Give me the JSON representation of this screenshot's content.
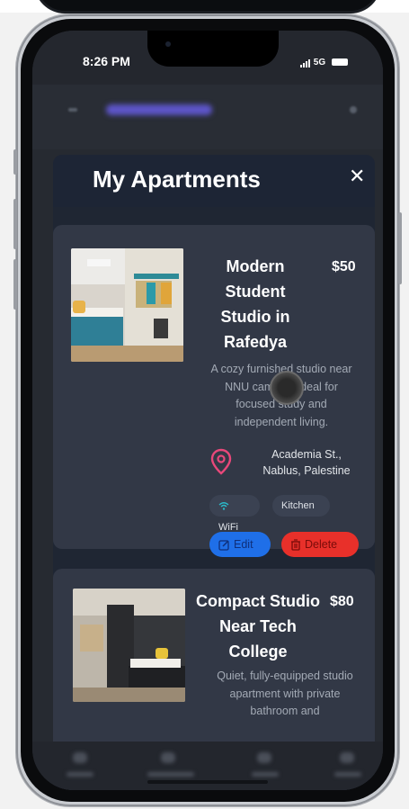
{
  "status_bar": {
    "time": "8:26 PM",
    "network": "5G"
  },
  "modal": {
    "title": "My Apartments",
    "close_label": "✕"
  },
  "apartments": [
    {
      "title": "Modern Student Studio in Rafedya",
      "price": "$50",
      "description": "A cozy furnished studio near NNU campus, ideal for focused study and independent living.",
      "location": "Academia St., Nablus, Palestine",
      "amenities": [
        "WiFi",
        "Kitchen"
      ],
      "edit_label": "Edit",
      "delete_label": "Delete"
    },
    {
      "title": "Compact Studio Near Tech College",
      "price": "$80",
      "description": "Quiet, fully-equipped studio apartment with private bathroom and"
    }
  ],
  "colors": {
    "accent": "#1f6fe8",
    "danger": "#e8302a",
    "location_pin": "#e8487a",
    "modal_bg": "#1d2535",
    "card_bg": "#323846"
  },
  "icons": [
    "location-pin-icon",
    "wifi-icon",
    "edit-icon",
    "trash-icon",
    "close-icon"
  ]
}
